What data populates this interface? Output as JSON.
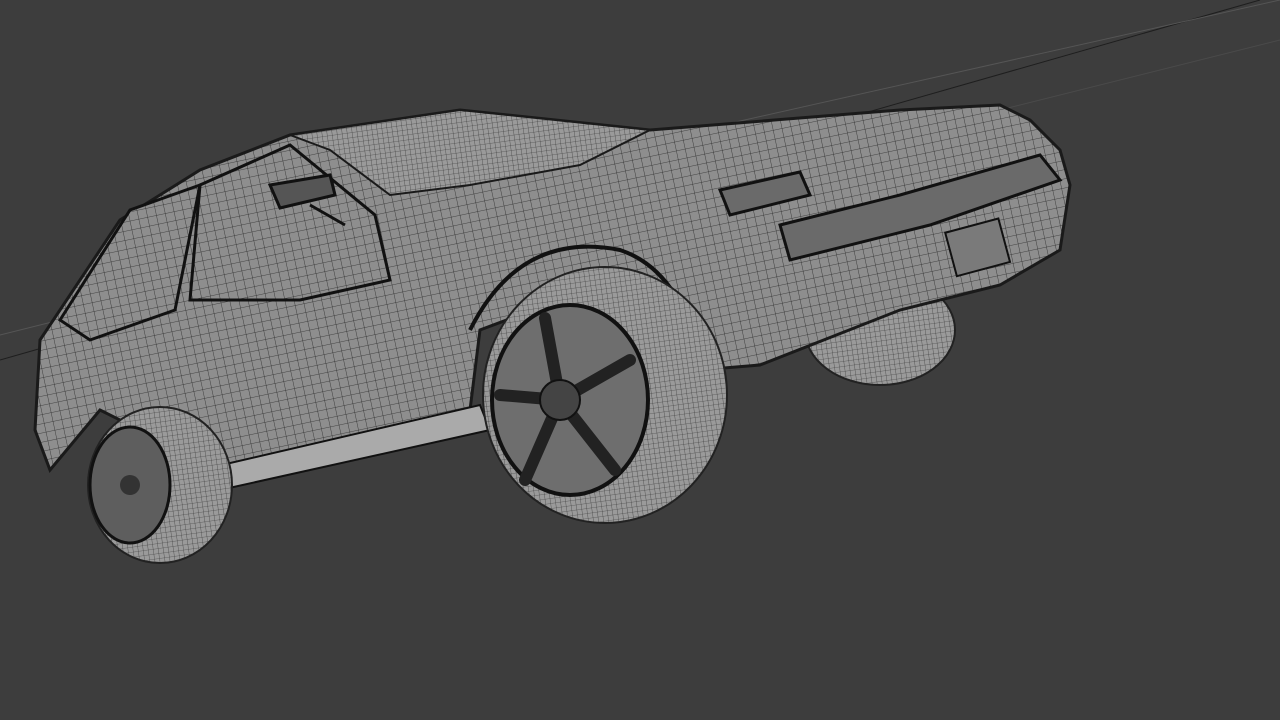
{
  "viewport": {
    "mode": "wireframe",
    "object": "car",
    "colors": {
      "background": "#3d3d3d",
      "mesh_fill": "#8e8e8e",
      "mesh_wire": "#1a1a1a",
      "tire": "#9a9a9a",
      "rim": "#6e6e6e"
    }
  }
}
